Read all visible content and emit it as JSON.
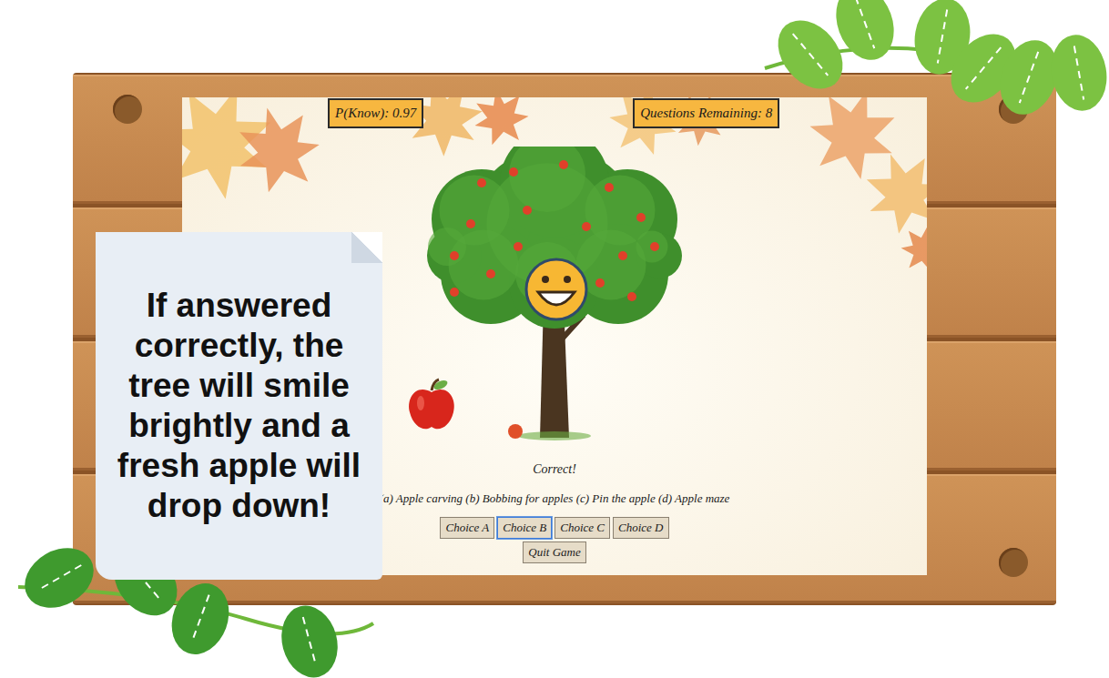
{
  "hud": {
    "p_know": "P(Know): 0.97",
    "questions_remaining": "Questions Remaining: 8"
  },
  "note": "If answered correctly, the tree will smile brightly and a fresh apple will drop down!",
  "answered_correctly": true,
  "feedback": "Correct!",
  "options_text": "(a) Apple carving (b) Bobbing for apples (c) Pin the apple (d) Apple maze",
  "choices": [
    {
      "label": "Choice A",
      "selected": false
    },
    {
      "label": "Choice B",
      "selected": true
    },
    {
      "label": "Choice C",
      "selected": false
    },
    {
      "label": "Choice D",
      "selected": false
    }
  ],
  "quit": "Quit Game"
}
